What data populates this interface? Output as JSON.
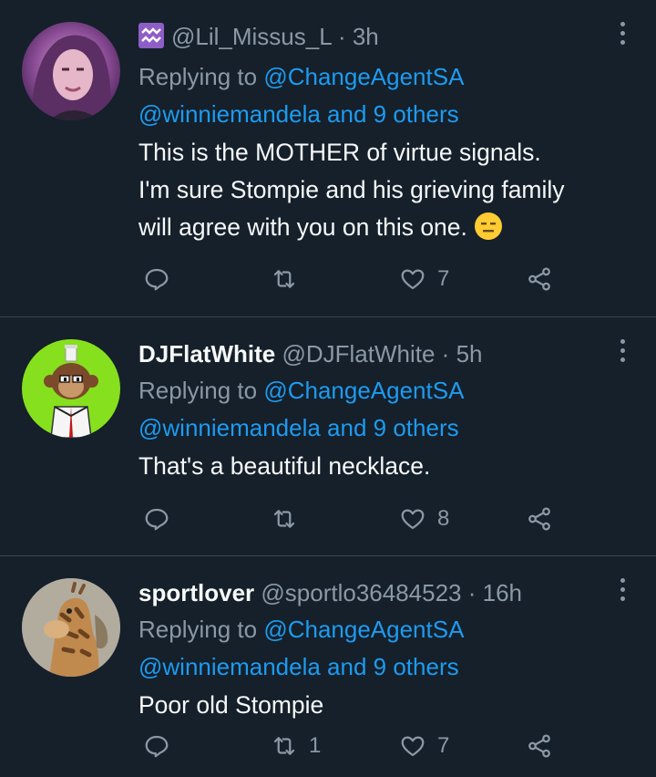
{
  "colors": {
    "background": "#15202b",
    "text": "#f7f9f9",
    "muted": "#8b98a5",
    "link": "#1d9bf0",
    "divider": "#38444d"
  },
  "tweets": [
    {
      "name": "",
      "handle": "@Lil_Missus_L",
      "time": "3h",
      "reply_prefix": "Replying to ",
      "reply_to_1": "@ChangeAgentSA",
      "reply_to_2": "@winniemandela and 9 others",
      "line1": "This is the MOTHER of virtue signals.",
      "line2": "I'm sure Stompie and his grieving family",
      "line3": "will agree with you on this one.",
      "emoji": "expressionless-face-emoji",
      "retweets": "",
      "likes": "7"
    },
    {
      "name": "DJFlatWhite",
      "handle": "@DJFlatWhite",
      "time": "5h",
      "reply_prefix": "Replying to ",
      "reply_to_1": "@ChangeAgentSA",
      "reply_to_2": "@winniemandela and 9 others",
      "line1": "That's a beautiful necklace.",
      "retweets": "",
      "likes": "8"
    },
    {
      "name": "sportlover",
      "handle": "@sportlo36484523",
      "time": "16h",
      "reply_prefix": "Replying to ",
      "reply_to_1": "@ChangeAgentSA",
      "reply_to_2": "@winniemandela and 9 others",
      "line1": "Poor old Stompie",
      "retweets": "1",
      "likes": "7"
    }
  ],
  "icons": [
    "aquarius-badge-icon",
    "more-icon",
    "reply-icon",
    "retweet-icon",
    "like-icon",
    "share-icon"
  ]
}
